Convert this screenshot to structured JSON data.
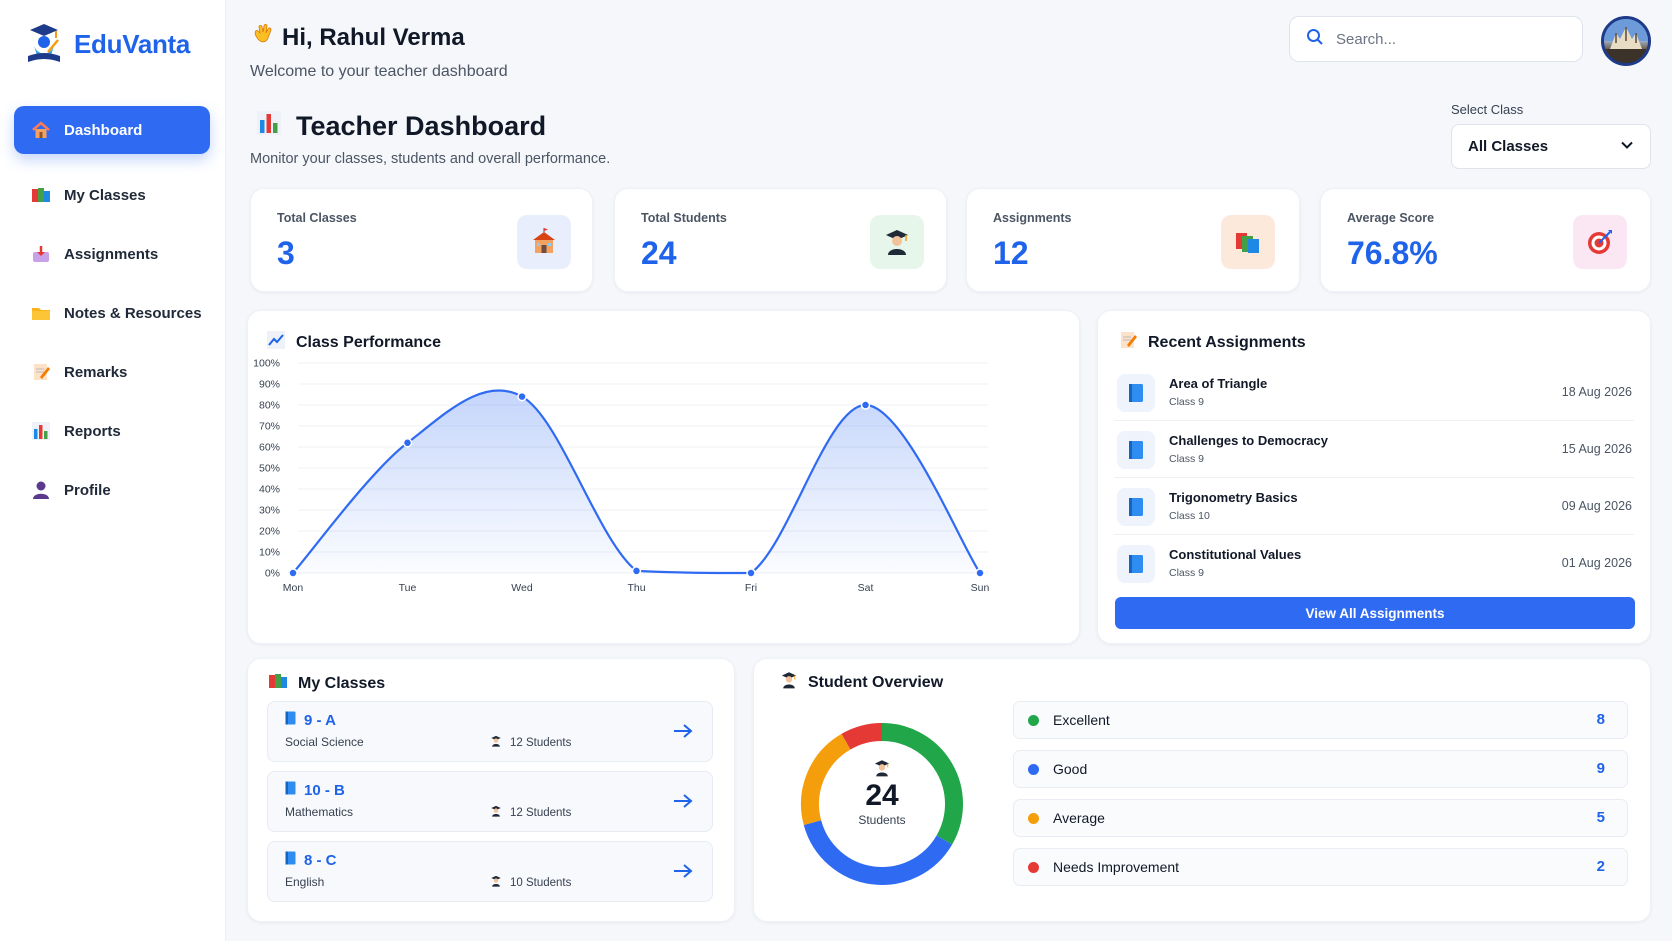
{
  "brand": {
    "name": "EduVanta"
  },
  "sidebar": {
    "items": [
      {
        "label": "Dashboard",
        "icon": "house-icon",
        "active": true
      },
      {
        "label": "My Classes",
        "icon": "books-icon"
      },
      {
        "label": "Assignments",
        "icon": "inbox-tray-icon"
      },
      {
        "label": "Notes & Resources",
        "icon": "folder-icon"
      },
      {
        "label": "Remarks",
        "icon": "memo-icon"
      },
      {
        "label": "Reports",
        "icon": "bar-chart-icon"
      },
      {
        "label": "Profile",
        "icon": "user-icon"
      }
    ]
  },
  "header": {
    "greeting": "Hi, Rahul Verma",
    "subtitle": "Welcome to your teacher dashboard",
    "search_placeholder": "Search..."
  },
  "dashboard": {
    "title": "Teacher Dashboard",
    "subtitle": "Monitor your classes, students and overall performance.",
    "select_label": "Select Class",
    "select_value": "All Classes"
  },
  "stats": [
    {
      "label": "Total Classes",
      "value": "3",
      "icon": "school-icon",
      "bg": "#e8eefb"
    },
    {
      "label": "Total Students",
      "value": "24",
      "icon": "graduate-icon",
      "bg": "#e7f6ea"
    },
    {
      "label": "Assignments",
      "value": "12",
      "icon": "books-icon",
      "bg": "#fde9dc"
    },
    {
      "label": "Average Score",
      "value": "76.8%",
      "icon": "target-icon",
      "bg": "#fbe6f4"
    }
  ],
  "performance": {
    "title": "Class Performance"
  },
  "chart_data": {
    "type": "area",
    "categories": [
      "Mon",
      "Tue",
      "Wed",
      "Thu",
      "Fri",
      "Sat",
      "Sun"
    ],
    "series": [
      {
        "values": [
          0,
          62,
          84,
          1,
          0,
          80,
          0
        ]
      }
    ],
    "y_ticks": [
      "0%",
      "10%",
      "20%",
      "30%",
      "40%",
      "50%",
      "60%",
      "70%",
      "80%",
      "90%",
      "100%"
    ],
    "ylim": [
      0,
      100
    ],
    "grid": true,
    "color": "#2f6bf2"
  },
  "assignments": {
    "title": "Recent Assignments",
    "items": [
      {
        "name": "Area of Triangle",
        "class": "Class 9",
        "date": "18 Aug 2026"
      },
      {
        "name": "Challenges to Democracy",
        "class": "Class 9",
        "date": "15 Aug 2026"
      },
      {
        "name": "Trigonometry Basics",
        "class": "Class 10",
        "date": "09 Aug 2026"
      },
      {
        "name": "Constitutional Values",
        "class": "Class 9",
        "date": "01 Aug 2026"
      }
    ],
    "button": "View All Assignments"
  },
  "classes": {
    "title": "My Classes",
    "items": [
      {
        "name": "9 - A",
        "subject": "Social Science",
        "students": "12 Students"
      },
      {
        "name": "10 - B",
        "subject": "Mathematics",
        "students": "12 Students"
      },
      {
        "name": "8 - C",
        "subject": "English",
        "students": "10 Students"
      }
    ]
  },
  "overview": {
    "title": "Student Overview",
    "total": "24",
    "total_label": "Students",
    "segments": [
      {
        "label": "Excellent",
        "count": "8",
        "value": 8,
        "color": "#22a64a"
      },
      {
        "label": "Good",
        "count": "9",
        "value": 9,
        "color": "#2f6bf2"
      },
      {
        "label": "Average",
        "count": "5",
        "value": 5,
        "color": "#f59e0b"
      },
      {
        "label": "Needs Improvement",
        "count": "2",
        "value": 2,
        "color": "#e53935"
      }
    ]
  }
}
